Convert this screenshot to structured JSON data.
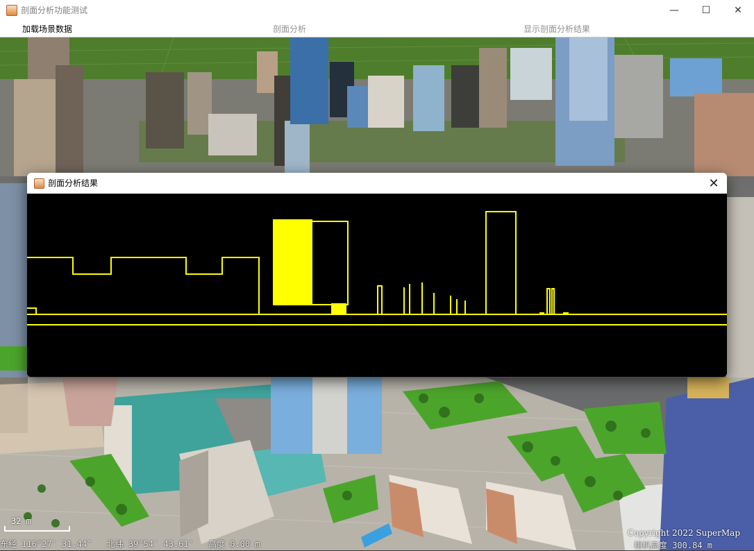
{
  "window": {
    "title": "剖面分析功能测试",
    "minimize_icon": "minimize-icon",
    "maximize_icon": "maximize-icon",
    "close_icon": "close-icon",
    "minimize_glyph": "—",
    "maximize_glyph": "☐",
    "close_glyph": "✕"
  },
  "menu": {
    "items": [
      {
        "label": "加载场景数据",
        "active": true
      },
      {
        "label": "剖面分析",
        "active": false
      },
      {
        "label": "显示剖面分析结果",
        "active": false
      }
    ]
  },
  "scene": {
    "scale_label": "32 m",
    "status": {
      "longitude": "东经 116°27′  31.44″",
      "latitude": "北纬 39°54′  43.61″",
      "height": "高度 0.00 m"
    },
    "copyright": "Copyright 2022 SuperMap",
    "camera_height": "相机高度 300.84 m"
  },
  "dialog": {
    "title": "剖面分析结果",
    "close_glyph": "✕",
    "line_color": "#ffff00",
    "background": "#000000"
  },
  "colors": {
    "profile_yellow": "#ffff00",
    "grass": "#4f7a2e",
    "title_gray": "#808080"
  }
}
